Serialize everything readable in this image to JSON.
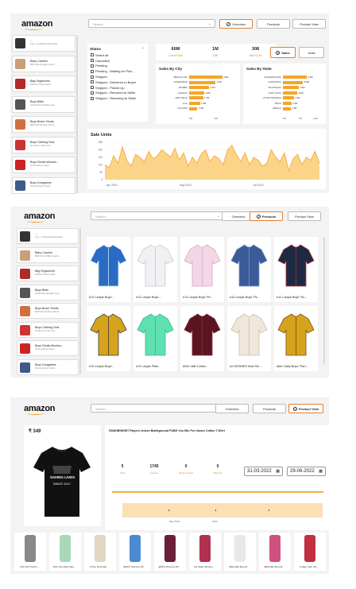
{
  "brand": {
    "logo": "amazon"
  },
  "nav": {
    "overview": "Overview",
    "products": "Products",
    "product_view": "Product View"
  },
  "search": {
    "placeholder": "Search"
  },
  "sidebar_items": [
    {
      "title": "...",
      "subtitle": "Ivory ~ All Weather Essentials"
    },
    {
      "title": "Baby Carriers",
      "subtitle": "BESTVALUE Baby Carrier..."
    },
    {
      "title": "Bag Organizers",
      "subtitle": "Zoltanas Travel Handl..."
    },
    {
      "title": "Boys Belts",
      "subtitle": "Handicraft Adjustable Leat..."
    },
    {
      "title": "Boys Boxer Shorts",
      "subtitle": "BESTVALUE Boys Kids B..."
    },
    {
      "title": "Boys Clothing Sets",
      "subtitle": "DJ Electron Kid's and ..."
    },
    {
      "title": "Boys Dhotis Mundus...",
      "subtitle": "Ha Ra Fashion Boys..."
    },
    {
      "title": "Boys Dungarees",
      "subtitle": "Proviolet Denim Solid..."
    }
  ],
  "filters": {
    "title": "Status",
    "options": [
      "Select all",
      "Cancelled",
      "Pending",
      "Pending - Waiting for Pick ...",
      "Shipped",
      "Shipped - Delivered to Buyer",
      "Shipped - Picked Up",
      "Shipped - Returned to Seller",
      "Shipped - Returning to Seller"
    ]
  },
  "kpis": [
    {
      "value": "66M",
      "label": "Overall Sale"
    },
    {
      "value": "1M",
      "label": "Sale"
    },
    {
      "value": "308",
      "label": "Sale Count"
    }
  ],
  "toggle": {
    "sales": "Sales",
    "units": "Units"
  },
  "sales_by_city": {
    "title": "Sales By City",
    "rows": [
      {
        "label": "BENGALURU",
        "value": 4,
        "text": "4.0M"
      },
      {
        "label": "HYDERABAD",
        "value": 3.2,
        "text": "3.2M"
      },
      {
        "label": "MUMBAI",
        "value": 2.4,
        "text": "2.4M"
      },
      {
        "label": "CHENNAI",
        "value": 1.8,
        "text": "1.8M"
      },
      {
        "label": "NEW DELHI",
        "value": 1.7,
        "text": "1.7M"
      },
      {
        "label": "pune",
        "value": 1.3,
        "text": "1.3M"
      },
      {
        "label": "KOLKATA",
        "value": 1.0,
        "text": "1.0M"
      }
    ],
    "ticks": [
      "0M",
      "5M"
    ]
  },
  "sales_by_state": {
    "title": "Sales By State",
    "rows": [
      {
        "label": "MAHARASHTRA",
        "value": 6.5,
        "text": "6.5M"
      },
      {
        "label": "KARNATAKA",
        "value": 5.5,
        "text": "5.5M"
      },
      {
        "label": "TELANGANA",
        "value": 4.3,
        "text": "4.3M"
      },
      {
        "label": "TAMIL NADU",
        "value": 3.9,
        "text": "3.9M"
      },
      {
        "label": "UTTAR PRADESH",
        "value": 3.0,
        "text": "3.0M"
      },
      {
        "label": "DELHI",
        "value": 2.3,
        "text": "2.3M"
      },
      {
        "label": "KERALA",
        "value": 2.1,
        "text": "2.1M"
      }
    ],
    "ticks": [
      "0M",
      "5M",
      "10M"
    ]
  },
  "chart_data": {
    "type": "area",
    "title": "Sale Units",
    "x": [
      "Apr 2022",
      "May 2022",
      "Jun 2022"
    ],
    "ylim": [
      0,
      250
    ],
    "yticks": [
      "0",
      "50",
      "100",
      "150",
      "200",
      "250"
    ],
    "values": [
      100,
      80,
      160,
      110,
      220,
      130,
      90,
      170,
      150,
      120,
      190,
      140,
      160,
      200,
      175,
      150,
      210,
      130,
      180,
      90,
      150,
      110,
      170,
      200,
      120,
      160,
      140,
      100,
      200,
      230,
      170,
      120,
      180,
      100,
      150,
      130,
      90,
      110,
      200,
      150,
      120,
      180,
      60,
      140,
      170,
      100,
      150,
      130,
      190,
      110
    ]
  },
  "products": [
    "e12 Lanjue Boys'...",
    "e12 Lanjue Boys'...",
    "e12 Lanjue Boys' Pli...",
    "e12 Lanjue Boys' Pli...",
    "e12 Lanjue Boys' Sh...",
    "e12 Lanjue Boys'...",
    "e12 Lanjue Plain...",
    "AKB Little Cotton...",
    "AJ DEZINES Kids Shi...",
    "Alien Sally Boys' Plan..."
  ],
  "product_view": {
    "price": "₹ 349",
    "title": "SWAHBNIHSIT Players Unisex Battleground PUBG You Win For Unisex Cotton T-Shirt",
    "tshirt_text": [
      "SAVING LIVES",
      "SINCE 2017"
    ],
    "stats": [
      {
        "value": "5",
        "label": "Units"
      },
      {
        "value": "1745",
        "label": "Amount"
      },
      {
        "value": "0",
        "label": "Return Count"
      },
      {
        "value": "0",
        "label": "Returns"
      }
    ],
    "date_from": "31-03-2022",
    "date_to": "29-06-2022",
    "axis_month": "May 2022",
    "axis_year": "2022"
  },
  "strip_items": [
    "CCK DIX Cotton...",
    "DIG-Two Mela Kids...",
    "Prism Decorate...",
    "@KFK Womens Bl...",
    "@KFK Womens Bl...",
    "KG Sales Shoppy...",
    "@Rouffle Boys B...",
    "@Rouffle Boys B...",
    "Fudge Carp Sts..."
  ],
  "colors": {
    "accent": "#f4a528",
    "active_border": "#e08030",
    "panel_bg": "#f3f3f3"
  }
}
